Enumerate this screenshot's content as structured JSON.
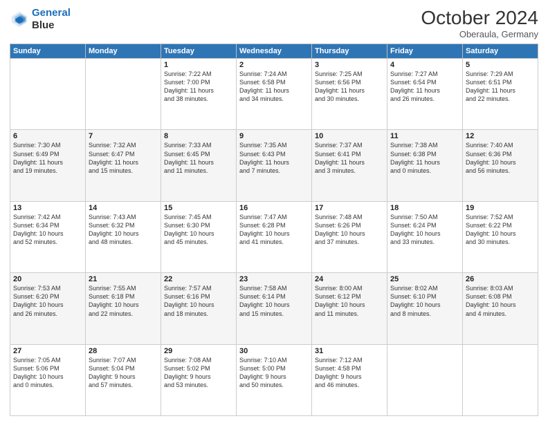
{
  "header": {
    "logo_line1": "General",
    "logo_line2": "Blue",
    "month": "October 2024",
    "location": "Oberaula, Germany"
  },
  "weekdays": [
    "Sunday",
    "Monday",
    "Tuesday",
    "Wednesday",
    "Thursday",
    "Friday",
    "Saturday"
  ],
  "weeks": [
    [
      {
        "day": "",
        "info": ""
      },
      {
        "day": "",
        "info": ""
      },
      {
        "day": "1",
        "info": "Sunrise: 7:22 AM\nSunset: 7:00 PM\nDaylight: 11 hours\nand 38 minutes."
      },
      {
        "day": "2",
        "info": "Sunrise: 7:24 AM\nSunset: 6:58 PM\nDaylight: 11 hours\nand 34 minutes."
      },
      {
        "day": "3",
        "info": "Sunrise: 7:25 AM\nSunset: 6:56 PM\nDaylight: 11 hours\nand 30 minutes."
      },
      {
        "day": "4",
        "info": "Sunrise: 7:27 AM\nSunset: 6:54 PM\nDaylight: 11 hours\nand 26 minutes."
      },
      {
        "day": "5",
        "info": "Sunrise: 7:29 AM\nSunset: 6:51 PM\nDaylight: 11 hours\nand 22 minutes."
      }
    ],
    [
      {
        "day": "6",
        "info": "Sunrise: 7:30 AM\nSunset: 6:49 PM\nDaylight: 11 hours\nand 19 minutes."
      },
      {
        "day": "7",
        "info": "Sunrise: 7:32 AM\nSunset: 6:47 PM\nDaylight: 11 hours\nand 15 minutes."
      },
      {
        "day": "8",
        "info": "Sunrise: 7:33 AM\nSunset: 6:45 PM\nDaylight: 11 hours\nand 11 minutes."
      },
      {
        "day": "9",
        "info": "Sunrise: 7:35 AM\nSunset: 6:43 PM\nDaylight: 11 hours\nand 7 minutes."
      },
      {
        "day": "10",
        "info": "Sunrise: 7:37 AM\nSunset: 6:41 PM\nDaylight: 11 hours\nand 3 minutes."
      },
      {
        "day": "11",
        "info": "Sunrise: 7:38 AM\nSunset: 6:38 PM\nDaylight: 11 hours\nand 0 minutes."
      },
      {
        "day": "12",
        "info": "Sunrise: 7:40 AM\nSunset: 6:36 PM\nDaylight: 10 hours\nand 56 minutes."
      }
    ],
    [
      {
        "day": "13",
        "info": "Sunrise: 7:42 AM\nSunset: 6:34 PM\nDaylight: 10 hours\nand 52 minutes."
      },
      {
        "day": "14",
        "info": "Sunrise: 7:43 AM\nSunset: 6:32 PM\nDaylight: 10 hours\nand 48 minutes."
      },
      {
        "day": "15",
        "info": "Sunrise: 7:45 AM\nSunset: 6:30 PM\nDaylight: 10 hours\nand 45 minutes."
      },
      {
        "day": "16",
        "info": "Sunrise: 7:47 AM\nSunset: 6:28 PM\nDaylight: 10 hours\nand 41 minutes."
      },
      {
        "day": "17",
        "info": "Sunrise: 7:48 AM\nSunset: 6:26 PM\nDaylight: 10 hours\nand 37 minutes."
      },
      {
        "day": "18",
        "info": "Sunrise: 7:50 AM\nSunset: 6:24 PM\nDaylight: 10 hours\nand 33 minutes."
      },
      {
        "day": "19",
        "info": "Sunrise: 7:52 AM\nSunset: 6:22 PM\nDaylight: 10 hours\nand 30 minutes."
      }
    ],
    [
      {
        "day": "20",
        "info": "Sunrise: 7:53 AM\nSunset: 6:20 PM\nDaylight: 10 hours\nand 26 minutes."
      },
      {
        "day": "21",
        "info": "Sunrise: 7:55 AM\nSunset: 6:18 PM\nDaylight: 10 hours\nand 22 minutes."
      },
      {
        "day": "22",
        "info": "Sunrise: 7:57 AM\nSunset: 6:16 PM\nDaylight: 10 hours\nand 18 minutes."
      },
      {
        "day": "23",
        "info": "Sunrise: 7:58 AM\nSunset: 6:14 PM\nDaylight: 10 hours\nand 15 minutes."
      },
      {
        "day": "24",
        "info": "Sunrise: 8:00 AM\nSunset: 6:12 PM\nDaylight: 10 hours\nand 11 minutes."
      },
      {
        "day": "25",
        "info": "Sunrise: 8:02 AM\nSunset: 6:10 PM\nDaylight: 10 hours\nand 8 minutes."
      },
      {
        "day": "26",
        "info": "Sunrise: 8:03 AM\nSunset: 6:08 PM\nDaylight: 10 hours\nand 4 minutes."
      }
    ],
    [
      {
        "day": "27",
        "info": "Sunrise: 7:05 AM\nSunset: 5:06 PM\nDaylight: 10 hours\nand 0 minutes."
      },
      {
        "day": "28",
        "info": "Sunrise: 7:07 AM\nSunset: 5:04 PM\nDaylight: 9 hours\nand 57 minutes."
      },
      {
        "day": "29",
        "info": "Sunrise: 7:08 AM\nSunset: 5:02 PM\nDaylight: 9 hours\nand 53 minutes."
      },
      {
        "day": "30",
        "info": "Sunrise: 7:10 AM\nSunset: 5:00 PM\nDaylight: 9 hours\nand 50 minutes."
      },
      {
        "day": "31",
        "info": "Sunrise: 7:12 AM\nSunset: 4:58 PM\nDaylight: 9 hours\nand 46 minutes."
      },
      {
        "day": "",
        "info": ""
      },
      {
        "day": "",
        "info": ""
      }
    ]
  ]
}
